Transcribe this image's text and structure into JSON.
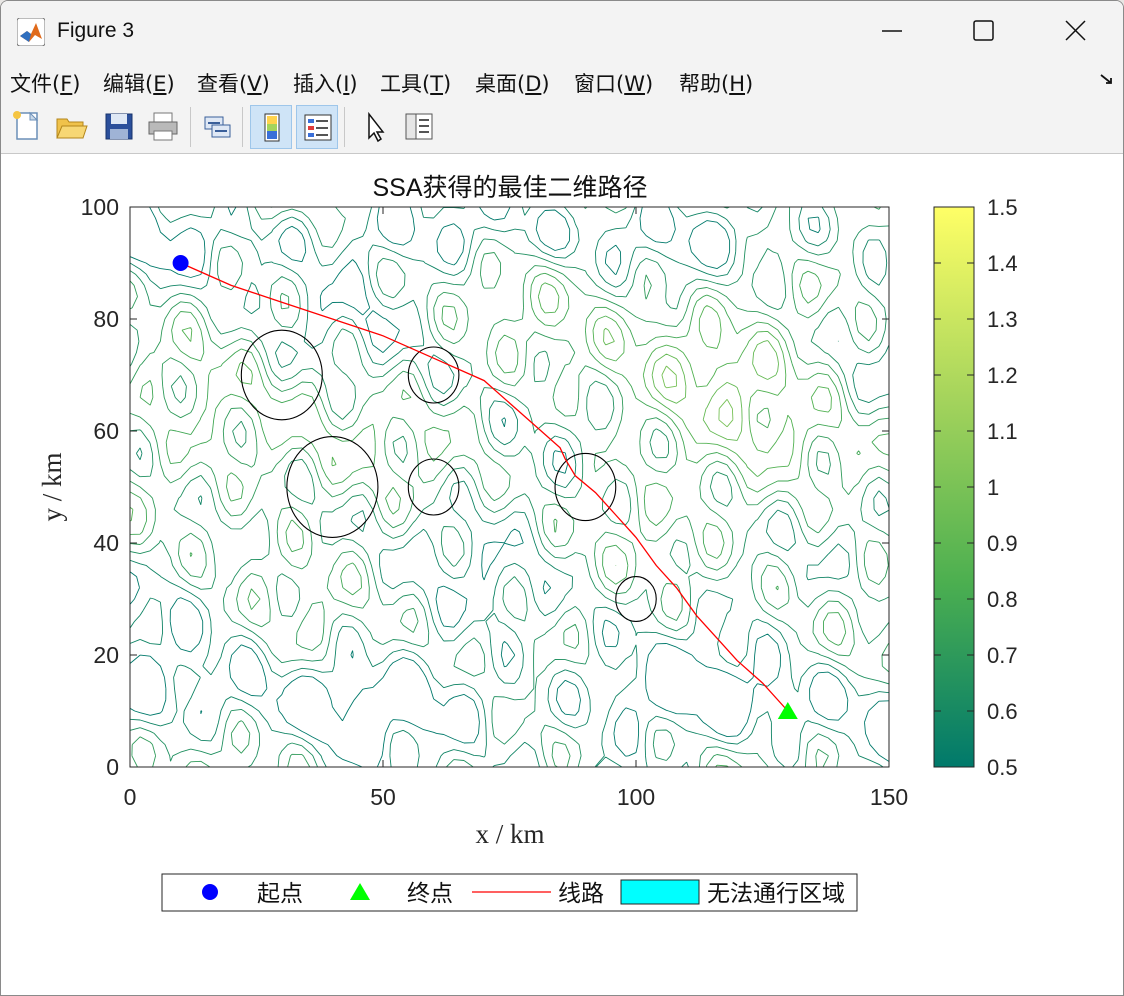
{
  "window": {
    "title": "Figure 3"
  },
  "menu": [
    {
      "label": "文件(",
      "acc": "F",
      "tail": ")"
    },
    {
      "label": "编辑(",
      "acc": "E",
      "tail": ")"
    },
    {
      "label": "查看(",
      "acc": "V",
      "tail": ")"
    },
    {
      "label": "插入(",
      "acc": "I",
      "tail": ")"
    },
    {
      "label": "工具(",
      "acc": "T",
      "tail": ")"
    },
    {
      "label": "桌面(",
      "acc": "D",
      "tail": ")"
    },
    {
      "label": "窗口(",
      "acc": "W",
      "tail": ")"
    },
    {
      "label": "帮助(",
      "acc": "H",
      "tail": ")"
    }
  ],
  "toolbar": [
    "new-figure-icon",
    "open-file-icon",
    "save-icon",
    "print-icon",
    "link-plot-icon",
    "colorbar-icon",
    "legend-icon",
    "pointer-icon",
    "property-inspector-icon"
  ],
  "chart_data": {
    "type": "contour",
    "title": "SSA获得的最佳二维路径",
    "xlabel": "x / km",
    "ylabel": "y / km",
    "xlim": [
      0,
      150
    ],
    "ylim": [
      0,
      100
    ],
    "xticks": [
      0,
      50,
      100,
      150
    ],
    "yticks": [
      0,
      20,
      40,
      60,
      80,
      100
    ],
    "colorbar": {
      "range": [
        0.5,
        1.5
      ],
      "ticks": [
        "0.5",
        "0.6",
        "0.7",
        "0.8",
        "0.9",
        "1",
        "1.1",
        "1.2",
        "1.3",
        "1.4",
        "1.5"
      ],
      "colormap": [
        "#00796b",
        "#4caf50",
        "#a5d45c",
        "#ffff66"
      ]
    },
    "start": {
      "x": 10,
      "y": 90,
      "color": "#0000ff"
    },
    "end": {
      "x": 130,
      "y": 10,
      "color": "#00ff00"
    },
    "path": {
      "color": "#ff0000",
      "points": [
        [
          10,
          90
        ],
        [
          20,
          86
        ],
        [
          30,
          83
        ],
        [
          40,
          80
        ],
        [
          50,
          77
        ],
        [
          60,
          73
        ],
        [
          70,
          69
        ],
        [
          75,
          65
        ],
        [
          80,
          61
        ],
        [
          85,
          57
        ],
        [
          86,
          55
        ],
        [
          88,
          52
        ],
        [
          92,
          49
        ],
        [
          96,
          45
        ],
        [
          100,
          41
        ],
        [
          104,
          36
        ],
        [
          108,
          32
        ],
        [
          112,
          27
        ],
        [
          116,
          23
        ],
        [
          120,
          19
        ],
        [
          125,
          15
        ],
        [
          130,
          10
        ]
      ]
    },
    "obstacles": [
      {
        "cx": 30,
        "cy": 70,
        "rx": 8,
        "ry": 8
      },
      {
        "cx": 60,
        "cy": 70,
        "rx": 5,
        "ry": 5
      },
      {
        "cx": 40,
        "cy": 50,
        "rx": 9,
        "ry": 9
      },
      {
        "cx": 60,
        "cy": 50,
        "rx": 5,
        "ry": 5
      },
      {
        "cx": 90,
        "cy": 50,
        "rx": 6,
        "ry": 6
      },
      {
        "cx": 100,
        "cy": 30,
        "rx": 4,
        "ry": 4
      }
    ],
    "legend": [
      {
        "label": "起点",
        "marker": "circle",
        "color": "#0000ff"
      },
      {
        "label": "终点",
        "marker": "triangle",
        "color": "#00ff00"
      },
      {
        "label": "线路",
        "marker": "line",
        "color": "#ff0000"
      },
      {
        "label": "无法通行区域",
        "marker": "rect",
        "color": "#00ffff"
      }
    ]
  }
}
